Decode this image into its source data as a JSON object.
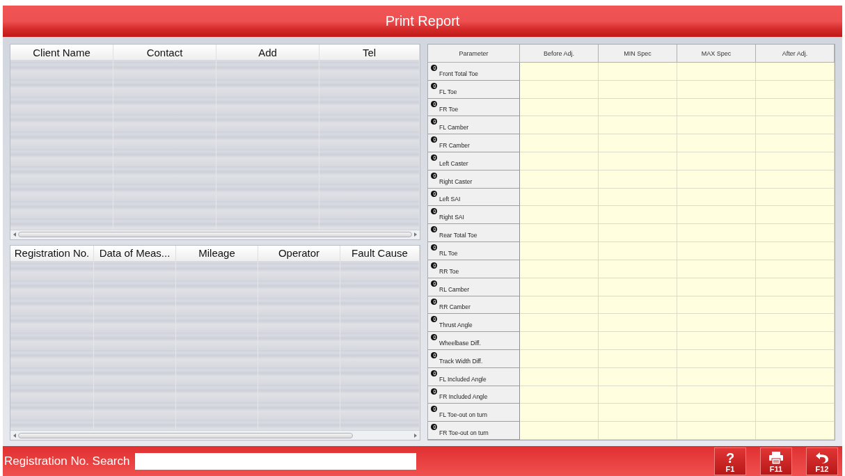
{
  "window": {
    "title": "Print Report"
  },
  "client_table": {
    "columns": [
      "Client Name",
      "Contact",
      "Add",
      "Tel"
    ]
  },
  "record_table": {
    "columns": [
      "Registration No.",
      "Data of Meas...",
      "Mileage",
      "Operator",
      "Fault Cause"
    ]
  },
  "parameter_table": {
    "columns": [
      "Parameter",
      "Before Adj.",
      "MIN Spec",
      "MAX Spec",
      "After Adj."
    ],
    "rows": [
      "Front Total Toe",
      "FL Toe",
      "FR Toe",
      "FL Camber",
      "FR Camber",
      "Left Caster",
      "Right Caster",
      "Left SAI",
      "Right SAI",
      "Rear Total Toe",
      "RL Toe",
      "RR Toe",
      "RL Camber",
      "RR Camber",
      "Thrust Angle",
      "Wheelbase Diff.",
      "Track Width Diff.",
      "FL Included Angle",
      "FR Included Angle",
      "FL Toe-out on turn",
      "FR Toe-out on turn"
    ]
  },
  "search": {
    "label": "Registration No. Search"
  },
  "buttons": [
    {
      "kind": "help",
      "glyph": "?",
      "key": "F1"
    },
    {
      "kind": "print",
      "key": "F11"
    },
    {
      "kind": "back",
      "key": "F12"
    }
  ]
}
